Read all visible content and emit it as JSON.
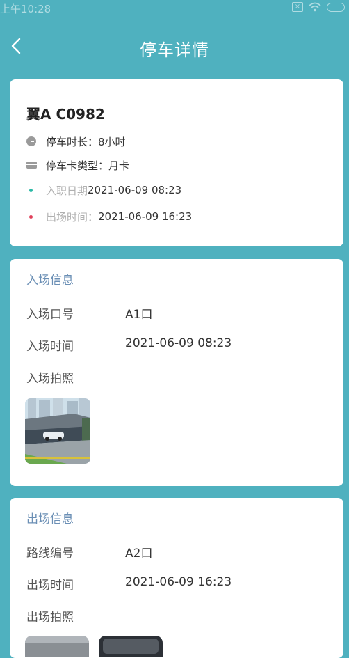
{
  "status_bar": {
    "time": "上午10:28",
    "icons": [
      "close-box-icon",
      "wifi-icon",
      "battery-icon"
    ]
  },
  "header": {
    "title": "停车详情",
    "back_icon": "chevron-left-icon"
  },
  "summary": {
    "plate": "翼A C0982",
    "rows": [
      {
        "icon": "clock-icon",
        "text": "停车时长：8小时"
      },
      {
        "icon": "card-icon",
        "text": "停车卡类型：月卡"
      },
      {
        "icon": "dot-green",
        "label": "入职日期",
        "value": "2021-06-09 08:23"
      },
      {
        "icon": "dot-red",
        "label": "出场时间：",
        "value": "2021-06-09 16:23"
      }
    ]
  },
  "entry": {
    "title": "入场信息",
    "gate_label": "入场口号",
    "gate_value": "A1口",
    "time_label": "入场时间",
    "time_value": "2021-06-09 08:23",
    "photo_label": "入场拍照"
  },
  "exit": {
    "title": "出场信息",
    "route_label": "路线编号",
    "route_value": "A2口",
    "time_label": "出场时间",
    "time_value": "2021-06-09 16:23",
    "photo_label": "出场拍照"
  },
  "colors": {
    "background": "#4fb1bf",
    "section_title": "#6b8fb5",
    "dot_green": "#2bb9a6",
    "dot_red": "#e0405a"
  }
}
